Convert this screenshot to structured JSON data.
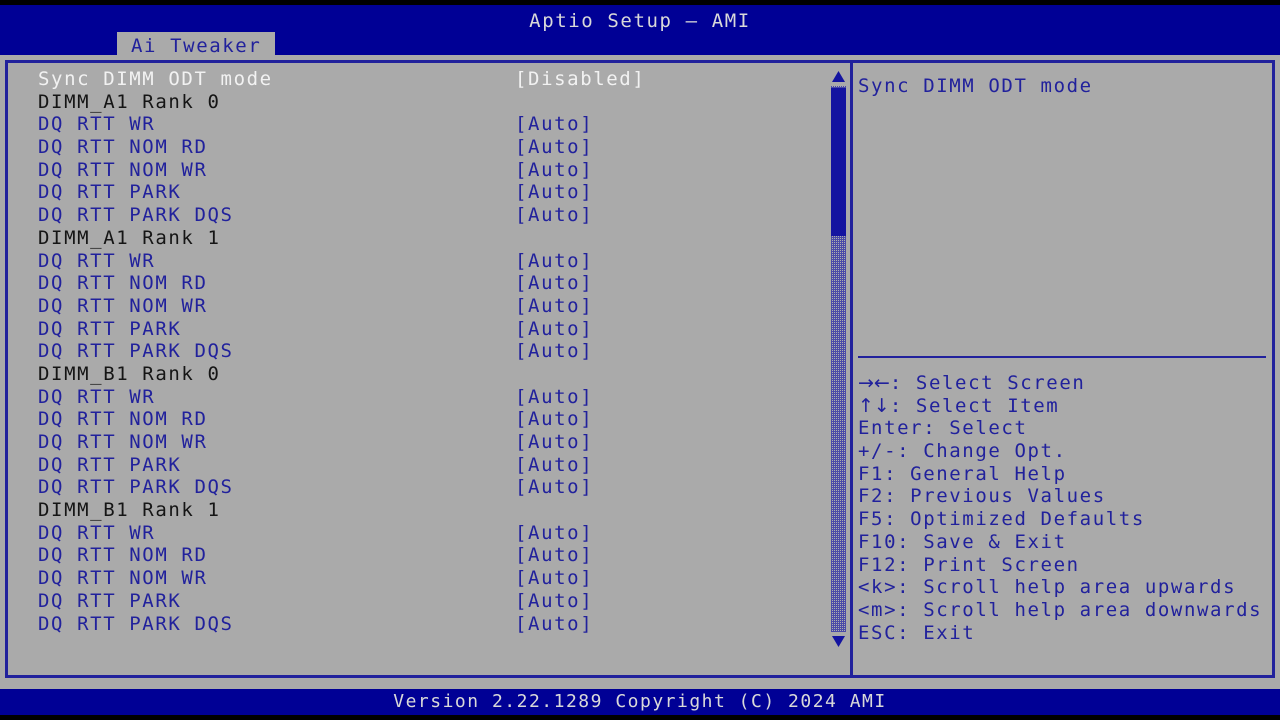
{
  "header": {
    "title": "Aptio Setup – AMI",
    "tab": "Ai Tweaker"
  },
  "colors": {
    "blue_bg": "#000095",
    "gray_bg": "#aaaaaa",
    "border_blue": "#21219c",
    "text_blue": "#21219c",
    "text_black": "#151515",
    "text_white": "#f2f2f2",
    "scroll_thumb": "#1414a0"
  },
  "menu": {
    "rows": [
      {
        "label": "Sync DIMM ODT mode",
        "value": "[Disabled]",
        "kind": "selected"
      },
      {
        "label": "DIMM_A1 Rank 0",
        "value": "",
        "kind": "header"
      },
      {
        "label": "DQ RTT WR",
        "value": "[Auto]",
        "kind": "option"
      },
      {
        "label": "DQ RTT NOM RD",
        "value": "[Auto]",
        "kind": "option"
      },
      {
        "label": "DQ RTT NOM WR",
        "value": "[Auto]",
        "kind": "option"
      },
      {
        "label": "DQ RTT PARK",
        "value": "[Auto]",
        "kind": "option"
      },
      {
        "label": "DQ RTT PARK DQS",
        "value": "[Auto]",
        "kind": "option"
      },
      {
        "label": "DIMM_A1 Rank 1",
        "value": "",
        "kind": "header"
      },
      {
        "label": "DQ RTT WR",
        "value": "[Auto]",
        "kind": "option"
      },
      {
        "label": "DQ RTT NOM RD",
        "value": "[Auto]",
        "kind": "option"
      },
      {
        "label": "DQ RTT NOM WR",
        "value": "[Auto]",
        "kind": "option"
      },
      {
        "label": "DQ RTT PARK",
        "value": "[Auto]",
        "kind": "option"
      },
      {
        "label": "DQ RTT PARK DQS",
        "value": "[Auto]",
        "kind": "option"
      },
      {
        "label": "DIMM_B1 Rank 0",
        "value": "",
        "kind": "header"
      },
      {
        "label": "DQ RTT WR",
        "value": "[Auto]",
        "kind": "option"
      },
      {
        "label": "DQ RTT NOM RD",
        "value": "[Auto]",
        "kind": "option"
      },
      {
        "label": "DQ RTT NOM WR",
        "value": "[Auto]",
        "kind": "option"
      },
      {
        "label": "DQ RTT PARK",
        "value": "[Auto]",
        "kind": "option"
      },
      {
        "label": "DQ RTT PARK DQS",
        "value": "[Auto]",
        "kind": "option"
      },
      {
        "label": "DIMM_B1 Rank 1",
        "value": "",
        "kind": "header"
      },
      {
        "label": "DQ RTT WR",
        "value": "[Auto]",
        "kind": "option"
      },
      {
        "label": "DQ RTT NOM RD",
        "value": "[Auto]",
        "kind": "option"
      },
      {
        "label": "DQ RTT NOM WR",
        "value": "[Auto]",
        "kind": "option"
      },
      {
        "label": "DQ RTT PARK",
        "value": "[Auto]",
        "kind": "option"
      },
      {
        "label": "DQ RTT PARK DQS",
        "value": "[Auto]",
        "kind": "option"
      }
    ]
  },
  "scrollbar": {
    "up_arrow_icon": "triangle-up-icon",
    "down_arrow_icon": "triangle-down-icon"
  },
  "help": {
    "text": "Sync DIMM ODT mode"
  },
  "legend": {
    "rows": [
      {
        "glyph": "→←",
        "text": ": Select Screen"
      },
      {
        "glyph": "↑↓",
        "text": ": Select Item"
      },
      {
        "glyph": "",
        "text": "Enter: Select"
      },
      {
        "glyph": "",
        "text": "+/-: Change Opt."
      },
      {
        "glyph": "",
        "text": "F1: General Help"
      },
      {
        "glyph": "",
        "text": "F2: Previous Values"
      },
      {
        "glyph": "",
        "text": "F5: Optimized Defaults"
      },
      {
        "glyph": "",
        "text": "F10: Save & Exit"
      },
      {
        "glyph": "",
        "text": "F12: Print Screen"
      },
      {
        "glyph": "",
        "text": "<k>: Scroll help area upwards"
      },
      {
        "glyph": "",
        "text": "<m>: Scroll help area downwards"
      },
      {
        "glyph": "",
        "text": "ESC: Exit"
      }
    ]
  },
  "footer": {
    "version": "Version 2.22.1289 Copyright (C) 2024 AMI"
  }
}
